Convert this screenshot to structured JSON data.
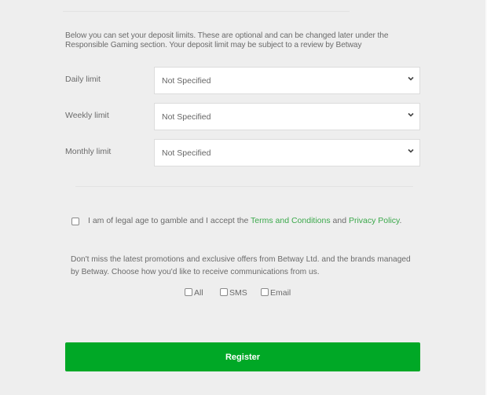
{
  "intro_text": "Below you can set your deposit limits. These are optional and can be changed later under the Responsible Gaming section. Your deposit limit may be subject to a review by Betway",
  "limits": [
    {
      "label": "Daily limit",
      "value": "Not Specified"
    },
    {
      "label": "Weekly limit",
      "value": "Not Specified"
    },
    {
      "label": "Monthly limit",
      "value": "Not Specified"
    }
  ],
  "icons": {
    "chevron": "chevron-down-icon",
    "checkbox": "checkbox-unchecked"
  },
  "terms": {
    "checked": false,
    "prefix": "I am of legal age to gamble and I accept the ",
    "terms_link": "Terms and Conditions",
    "middle": " and ",
    "privacy_link": "Privacy Policy",
    "suffix": "."
  },
  "promo_text": "Don't miss the latest promotions and exclusive offers from Betway Ltd. and the brands managed by Betway. Choose how you'd like to receive communications from us.",
  "communications": [
    {
      "label": "All",
      "checked": false
    },
    {
      "label": "SMS",
      "checked": false
    },
    {
      "label": "Email",
      "checked": false
    }
  ],
  "register_label": "Register",
  "colors": {
    "accent": "#00a826",
    "link": "#3aa84a",
    "background": "#eeeeee"
  }
}
